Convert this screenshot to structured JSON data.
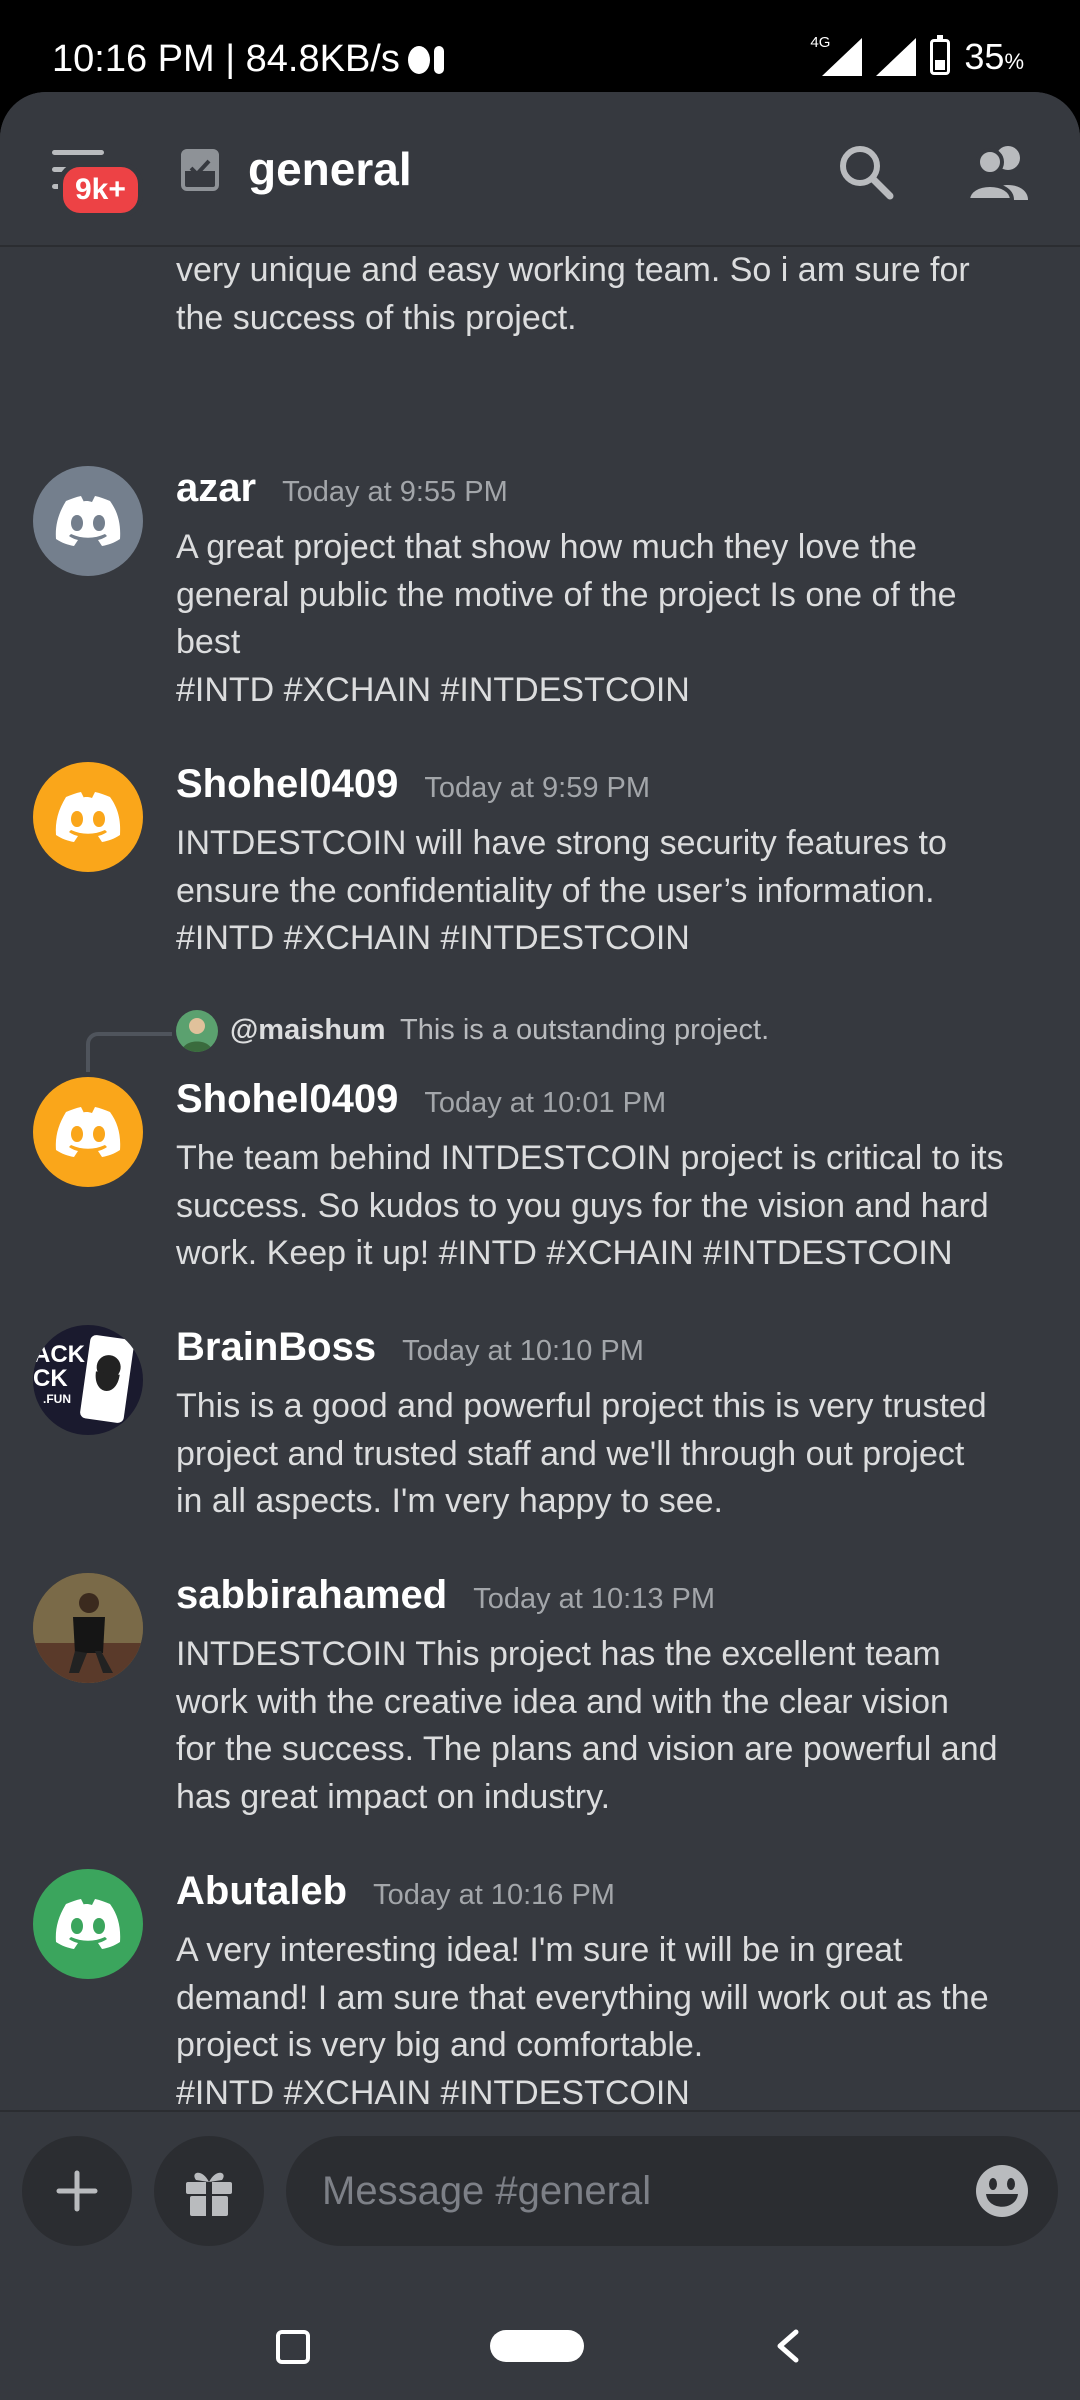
{
  "status_bar": {
    "time_speed": "10:16 PM | 84.8KB/s",
    "network": "4G",
    "battery_pct": "35",
    "battery_unit": "%"
  },
  "header": {
    "badge": "9k+",
    "channel": "general",
    "channel_icon": "text-channel-rules-icon",
    "icons": [
      "search-icon",
      "members-icon"
    ]
  },
  "messages": [
    {
      "username": "",
      "timestamp": "",
      "lines": [
        "very unique and easy working team. So i am sure for",
        "the success of this project."
      ]
    },
    {
      "username": "azar",
      "timestamp": "Today at 9:55 PM",
      "avatar_color": "#747f8d",
      "lines": [
        "A great project that show how much they love the",
        "general public the motive of the project Is one of the",
        "best",
        "#INTD #XCHAIN  #INTDESTCOIN"
      ]
    },
    {
      "username": "Shohel0409",
      "timestamp": "Today at 9:59 PM",
      "avatar_color": "#faa61a",
      "lines": [
        "INTDESTCOIN will have strong security features to",
        "ensure the confidentiality of the user’s information.",
        "#INTD #XCHAIN  #INTDESTCOIN"
      ]
    },
    {
      "username": "Shohel0409",
      "timestamp": "Today at 10:01 PM",
      "avatar_color": "#faa61a",
      "reply_to": {
        "name": "@maishum",
        "text": "This is a outstanding project."
      },
      "lines": [
        "The team behind INTDESTCOIN project is critical to its",
        "success. So kudos to you guys for the vision and hard",
        "work. Keep it up! #INTD #XCHAIN  #INTDESTCOIN"
      ]
    },
    {
      "username": "BrainBoss",
      "timestamp": "Today at 10:10 PM",
      "avatar_color": "#1a1a2e",
      "avatar_text": [
        "ACK",
        "CK",
        ".FUN"
      ],
      "lines": [
        "This is a good and powerful project this is very trusted",
        "project and trusted staff and we'll through out project",
        "in all aspects. I'm very happy to see."
      ]
    },
    {
      "username": "sabbirahamed",
      "timestamp": "Today at 10:13 PM",
      "avatar_color": "#6b5a3a",
      "lines": [
        "INTDESTCOIN This project has the excellent team",
        "work with the creative idea and with the clear vision",
        "for the success. The plans and vision are powerful and",
        "has great impact on industry."
      ]
    },
    {
      "username": "Abutaleb",
      "timestamp": "Today at 10:16 PM",
      "avatar_color": "#3ba55d",
      "lines": [
        "A very interesting idea! I'm sure it will be in great",
        "demand! I am sure that everything will work out as the",
        "project is very big and comfortable.",
        "#INTD #XCHAIN  #INTDESTCOIN"
      ]
    }
  ],
  "composer": {
    "placeholder": "Message #general",
    "icons": [
      "plus-icon",
      "gift-icon",
      "emoji-icon"
    ]
  },
  "navbar": {
    "icons": [
      "recents-icon",
      "home-pill-icon",
      "back-icon"
    ]
  }
}
